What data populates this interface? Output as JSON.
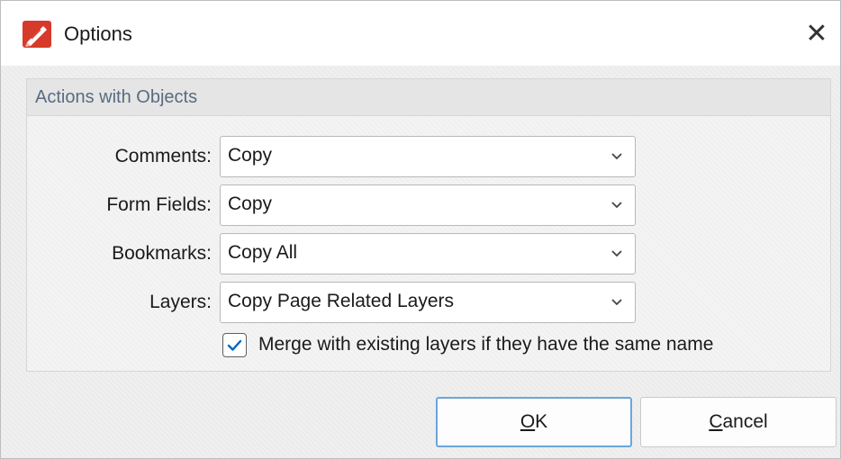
{
  "window": {
    "title": "Options",
    "app_icon": "pdf-editor-logo-icon",
    "close_symbol": "✕"
  },
  "group": {
    "title": "Actions with Objects"
  },
  "fields": {
    "comments": {
      "label": "Comments:",
      "value": "Copy"
    },
    "form_fields": {
      "label": "Form Fields:",
      "value": "Copy"
    },
    "bookmarks": {
      "label": "Bookmarks:",
      "value": "Copy All"
    },
    "layers": {
      "label": "Layers:",
      "value": "Copy Page Related Layers"
    }
  },
  "merge_checkbox": {
    "label": "Merge with existing layers if they have the same name",
    "checked": true
  },
  "buttons": {
    "ok": {
      "accel": "O",
      "rest": "K"
    },
    "cancel": {
      "accel": "C",
      "rest": "ancel"
    }
  },
  "colors": {
    "accent": "#0067c0",
    "brand": "#d63a2a",
    "group_title": "#596b80",
    "default_button_border": "#6aa6dc"
  }
}
